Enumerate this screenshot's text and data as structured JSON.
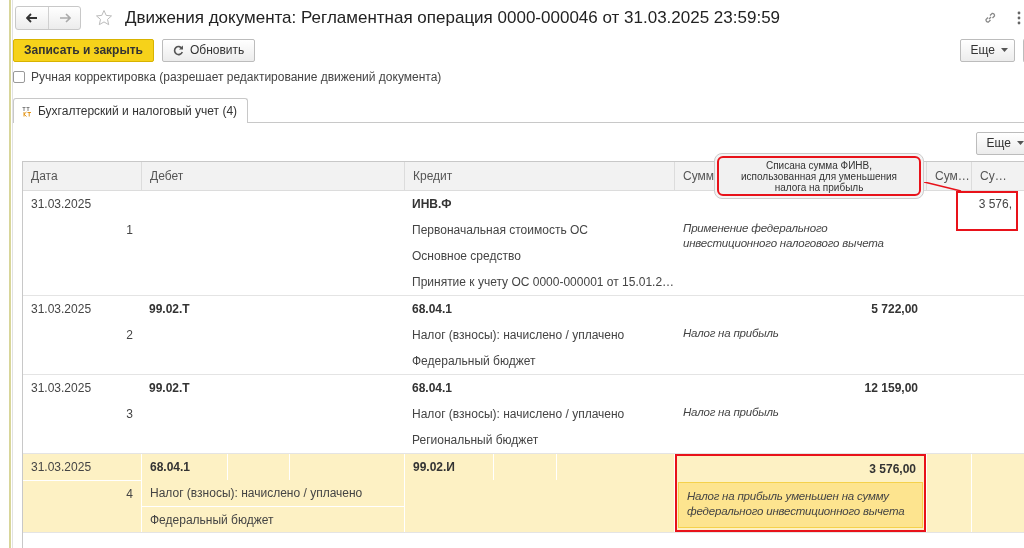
{
  "title": "Движения документа: Регламентная операция 0000-000046 от 31.03.2025 23:59:59",
  "commands": [
    {
      "label": "Записать и закрыть",
      "kind": "primary"
    },
    {
      "label": "Обновить",
      "kind": "refresh"
    }
  ],
  "more_button": "Еще",
  "manual_correction": {
    "label": "Ручная корректировка (разрешает редактирование движений документа)",
    "checked": false
  },
  "tabs": [
    {
      "label": "Бухгалтерский и налоговый учет (4)",
      "selected": true
    }
  ],
  "table_more_button": "Еще",
  "table": {
    "columns": [
      "Дата",
      "Дебет",
      "Кредит",
      "Сумм",
      "Сум…",
      "Су…"
    ],
    "rows": [
      {
        "date": "31.03.2025",
        "number": "1",
        "debit": {},
        "credit": {
          "account": "ИНВ.Ф",
          "lines": [
            "Первоначальная стоимость ОС",
            "Основное средство",
            "Принятие к учету ОС 0000-000001 от 15.01.2…"
          ]
        },
        "content": "Применение федерального инвестиционного налогового вычета",
        "column_6": "3 576,",
        "selected": false,
        "amount_framed": false,
        "column_6_framed": true
      },
      {
        "date": "31.03.2025",
        "number": "2",
        "debit": {
          "account": "99.02.Т"
        },
        "credit": {
          "account": "68.04.1",
          "lines": [
            "Налог (взносы): начислено / уплачено",
            "Федеральный бюджет"
          ]
        },
        "amount": "5 722,00",
        "content": "Налог на прибыль",
        "selected": false,
        "amount_framed": false,
        "column_6_framed": false
      },
      {
        "date": "31.03.2025",
        "number": "3",
        "debit": {
          "account": "99.02.Т"
        },
        "credit": {
          "account": "68.04.1",
          "lines": [
            "Налог (взносы): начислено / уплачено",
            "Региональный бюджет"
          ]
        },
        "amount": "12 159,00",
        "content": "Налог на прибыль",
        "selected": false,
        "amount_framed": false,
        "column_6_framed": false
      },
      {
        "date": "31.03.2025",
        "number": "4",
        "debit": {
          "account": "68.04.1",
          "lines": [
            "Налог (взносы): начислено / уплачено",
            "Федеральный бюджет"
          ]
        },
        "credit": {
          "account": "99.02.И"
        },
        "amount": "3 576,00",
        "content": "Налог на прибыль уменьшен на сумму федерального инвестиционного вычета",
        "selected": true,
        "amount_framed": true,
        "column_6_framed": false
      }
    ]
  },
  "callout": {
    "text": "Списана сумма ФИНВ, использованная для уменьшения налога на прибыль"
  }
}
